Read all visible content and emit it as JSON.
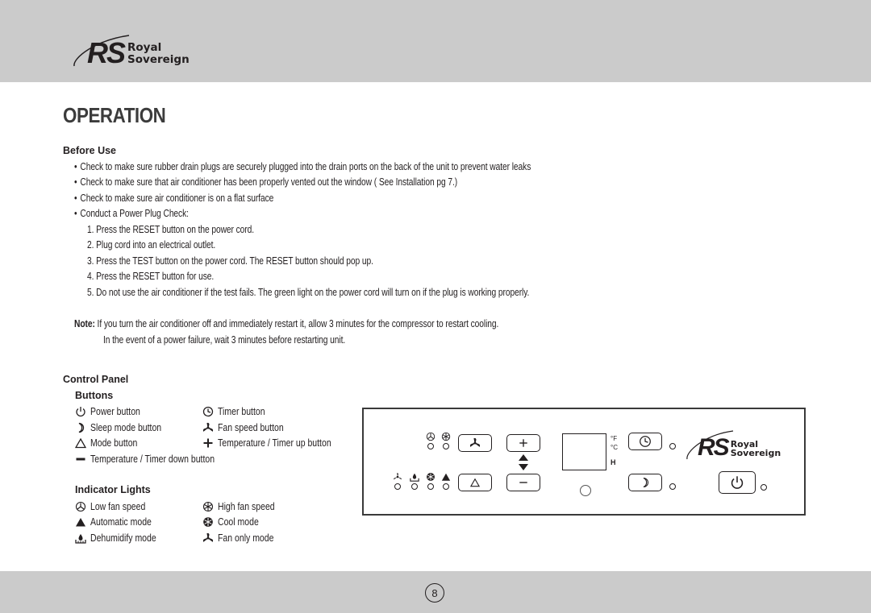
{
  "brand": {
    "monogram": "RS",
    "name_line1": "Royal",
    "name_line2": "Sovereign"
  },
  "page_title": "OPERATION",
  "before_use": {
    "heading": "Before Use",
    "bullets": [
      "Check to make sure rubber drain plugs are securely plugged into the drain ports on the back of the unit to prevent water leaks",
      "Check to make sure that air conditioner has been properly vented out the window ( See Installation pg 7.)",
      "Check to make sure air conditioner is on a flat surface",
      "Conduct a Power Plug Check:"
    ],
    "steps": [
      "1. Press the RESET button on the power cord.",
      "2. Plug cord into an electrical outlet.",
      "3. Press the TEST button on the power cord.  The RESET button should pop up.",
      "4. Press the RESET button for use.",
      "5. Do not use the air conditioner if the test fails.  The green light on the power cord will turn on if the plug is working properly."
    ],
    "note_label": "Note:",
    "note_line1": "If you turn the air conditioner off and immediately restart it, allow 3 minutes for the compressor to restart cooling.",
    "note_line2": "In the event of a power failure, wait 3 minutes before restarting unit."
  },
  "control_panel": {
    "heading": "Control Panel",
    "buttons_heading": "Buttons",
    "buttons": [
      {
        "icon": "power-icon",
        "label": "Power button"
      },
      {
        "icon": "timer-icon",
        "label": "Timer button"
      },
      {
        "icon": "sleep-moon-icon",
        "label": "Sleep mode button"
      },
      {
        "icon": "fan-icon",
        "label": "Fan speed button"
      },
      {
        "icon": "mode-triangle-icon",
        "label": "Mode button"
      },
      {
        "icon": "plus-icon",
        "label": "Temperature / Timer up button"
      },
      {
        "icon": "minus-icon",
        "label": "Temperature / Timer down button"
      }
    ],
    "indicators_heading": "Indicator Lights",
    "indicators": [
      {
        "icon": "low-fan-icon",
        "label": "Low fan speed"
      },
      {
        "icon": "high-fan-icon",
        "label": "High fan speed"
      },
      {
        "icon": "auto-mode-icon",
        "label": "Automatic mode"
      },
      {
        "icon": "cool-snowflake-icon",
        "label": "Cool mode"
      },
      {
        "icon": "dehumidify-icon",
        "label": "Dehumidify mode"
      },
      {
        "icon": "fan-only-icon",
        "label": "Fan only mode"
      }
    ],
    "diagram": {
      "unit_f": "°F",
      "unit_c": "°C",
      "humidity_label": "H"
    }
  },
  "page_number": "8"
}
